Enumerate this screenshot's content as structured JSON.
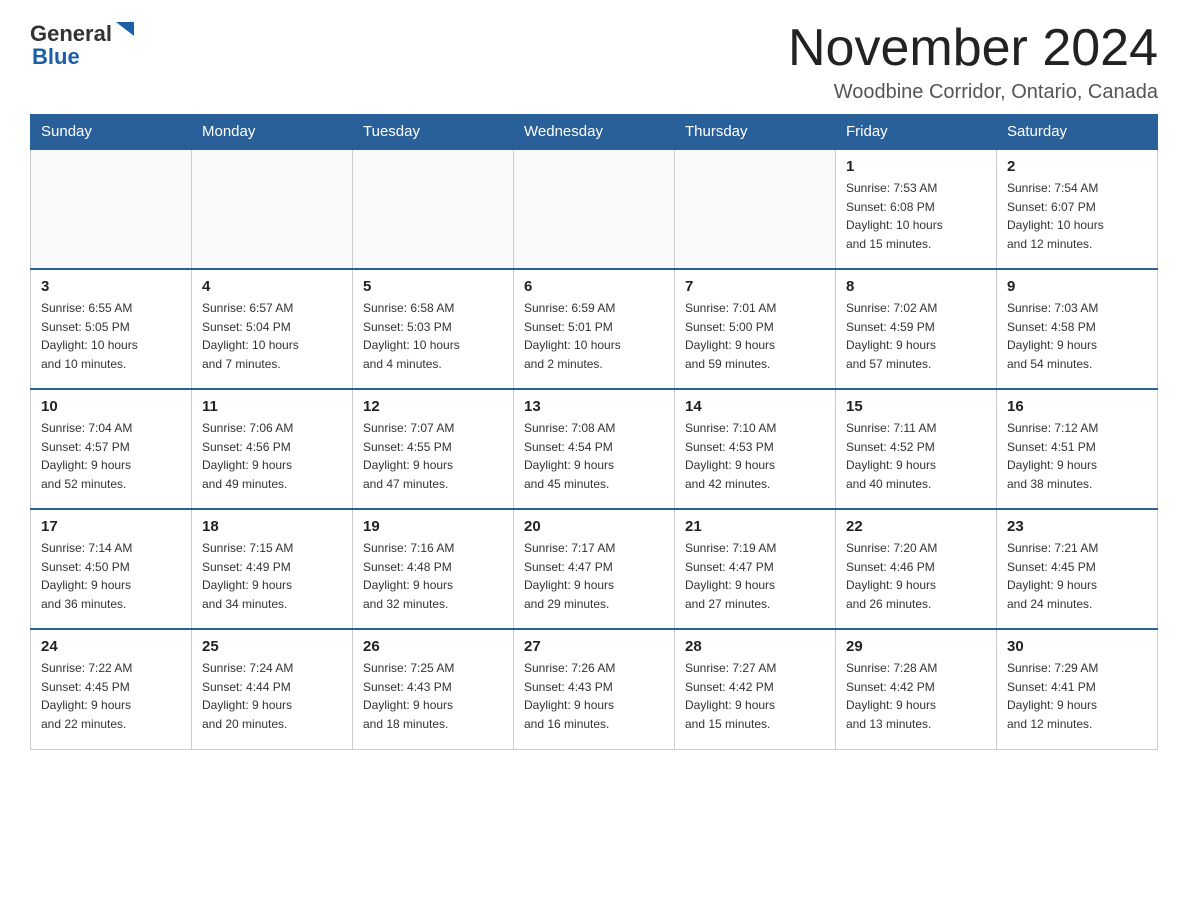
{
  "header": {
    "title": "November 2024",
    "subtitle": "Woodbine Corridor, Ontario, Canada",
    "logo_general": "General",
    "logo_blue": "Blue"
  },
  "calendar": {
    "days_of_week": [
      "Sunday",
      "Monday",
      "Tuesday",
      "Wednesday",
      "Thursday",
      "Friday",
      "Saturday"
    ],
    "weeks": [
      [
        {
          "day": "",
          "detail": ""
        },
        {
          "day": "",
          "detail": ""
        },
        {
          "day": "",
          "detail": ""
        },
        {
          "day": "",
          "detail": ""
        },
        {
          "day": "",
          "detail": ""
        },
        {
          "day": "1",
          "detail": "Sunrise: 7:53 AM\nSunset: 6:08 PM\nDaylight: 10 hours\nand 15 minutes."
        },
        {
          "day": "2",
          "detail": "Sunrise: 7:54 AM\nSunset: 6:07 PM\nDaylight: 10 hours\nand 12 minutes."
        }
      ],
      [
        {
          "day": "3",
          "detail": "Sunrise: 6:55 AM\nSunset: 5:05 PM\nDaylight: 10 hours\nand 10 minutes."
        },
        {
          "day": "4",
          "detail": "Sunrise: 6:57 AM\nSunset: 5:04 PM\nDaylight: 10 hours\nand 7 minutes."
        },
        {
          "day": "5",
          "detail": "Sunrise: 6:58 AM\nSunset: 5:03 PM\nDaylight: 10 hours\nand 4 minutes."
        },
        {
          "day": "6",
          "detail": "Sunrise: 6:59 AM\nSunset: 5:01 PM\nDaylight: 10 hours\nand 2 minutes."
        },
        {
          "day": "7",
          "detail": "Sunrise: 7:01 AM\nSunset: 5:00 PM\nDaylight: 9 hours\nand 59 minutes."
        },
        {
          "day": "8",
          "detail": "Sunrise: 7:02 AM\nSunset: 4:59 PM\nDaylight: 9 hours\nand 57 minutes."
        },
        {
          "day": "9",
          "detail": "Sunrise: 7:03 AM\nSunset: 4:58 PM\nDaylight: 9 hours\nand 54 minutes."
        }
      ],
      [
        {
          "day": "10",
          "detail": "Sunrise: 7:04 AM\nSunset: 4:57 PM\nDaylight: 9 hours\nand 52 minutes."
        },
        {
          "day": "11",
          "detail": "Sunrise: 7:06 AM\nSunset: 4:56 PM\nDaylight: 9 hours\nand 49 minutes."
        },
        {
          "day": "12",
          "detail": "Sunrise: 7:07 AM\nSunset: 4:55 PM\nDaylight: 9 hours\nand 47 minutes."
        },
        {
          "day": "13",
          "detail": "Sunrise: 7:08 AM\nSunset: 4:54 PM\nDaylight: 9 hours\nand 45 minutes."
        },
        {
          "day": "14",
          "detail": "Sunrise: 7:10 AM\nSunset: 4:53 PM\nDaylight: 9 hours\nand 42 minutes."
        },
        {
          "day": "15",
          "detail": "Sunrise: 7:11 AM\nSunset: 4:52 PM\nDaylight: 9 hours\nand 40 minutes."
        },
        {
          "day": "16",
          "detail": "Sunrise: 7:12 AM\nSunset: 4:51 PM\nDaylight: 9 hours\nand 38 minutes."
        }
      ],
      [
        {
          "day": "17",
          "detail": "Sunrise: 7:14 AM\nSunset: 4:50 PM\nDaylight: 9 hours\nand 36 minutes."
        },
        {
          "day": "18",
          "detail": "Sunrise: 7:15 AM\nSunset: 4:49 PM\nDaylight: 9 hours\nand 34 minutes."
        },
        {
          "day": "19",
          "detail": "Sunrise: 7:16 AM\nSunset: 4:48 PM\nDaylight: 9 hours\nand 32 minutes."
        },
        {
          "day": "20",
          "detail": "Sunrise: 7:17 AM\nSunset: 4:47 PM\nDaylight: 9 hours\nand 29 minutes."
        },
        {
          "day": "21",
          "detail": "Sunrise: 7:19 AM\nSunset: 4:47 PM\nDaylight: 9 hours\nand 27 minutes."
        },
        {
          "day": "22",
          "detail": "Sunrise: 7:20 AM\nSunset: 4:46 PM\nDaylight: 9 hours\nand 26 minutes."
        },
        {
          "day": "23",
          "detail": "Sunrise: 7:21 AM\nSunset: 4:45 PM\nDaylight: 9 hours\nand 24 minutes."
        }
      ],
      [
        {
          "day": "24",
          "detail": "Sunrise: 7:22 AM\nSunset: 4:45 PM\nDaylight: 9 hours\nand 22 minutes."
        },
        {
          "day": "25",
          "detail": "Sunrise: 7:24 AM\nSunset: 4:44 PM\nDaylight: 9 hours\nand 20 minutes."
        },
        {
          "day": "26",
          "detail": "Sunrise: 7:25 AM\nSunset: 4:43 PM\nDaylight: 9 hours\nand 18 minutes."
        },
        {
          "day": "27",
          "detail": "Sunrise: 7:26 AM\nSunset: 4:43 PM\nDaylight: 9 hours\nand 16 minutes."
        },
        {
          "day": "28",
          "detail": "Sunrise: 7:27 AM\nSunset: 4:42 PM\nDaylight: 9 hours\nand 15 minutes."
        },
        {
          "day": "29",
          "detail": "Sunrise: 7:28 AM\nSunset: 4:42 PM\nDaylight: 9 hours\nand 13 minutes."
        },
        {
          "day": "30",
          "detail": "Sunrise: 7:29 AM\nSunset: 4:41 PM\nDaylight: 9 hours\nand 12 minutes."
        }
      ]
    ]
  }
}
